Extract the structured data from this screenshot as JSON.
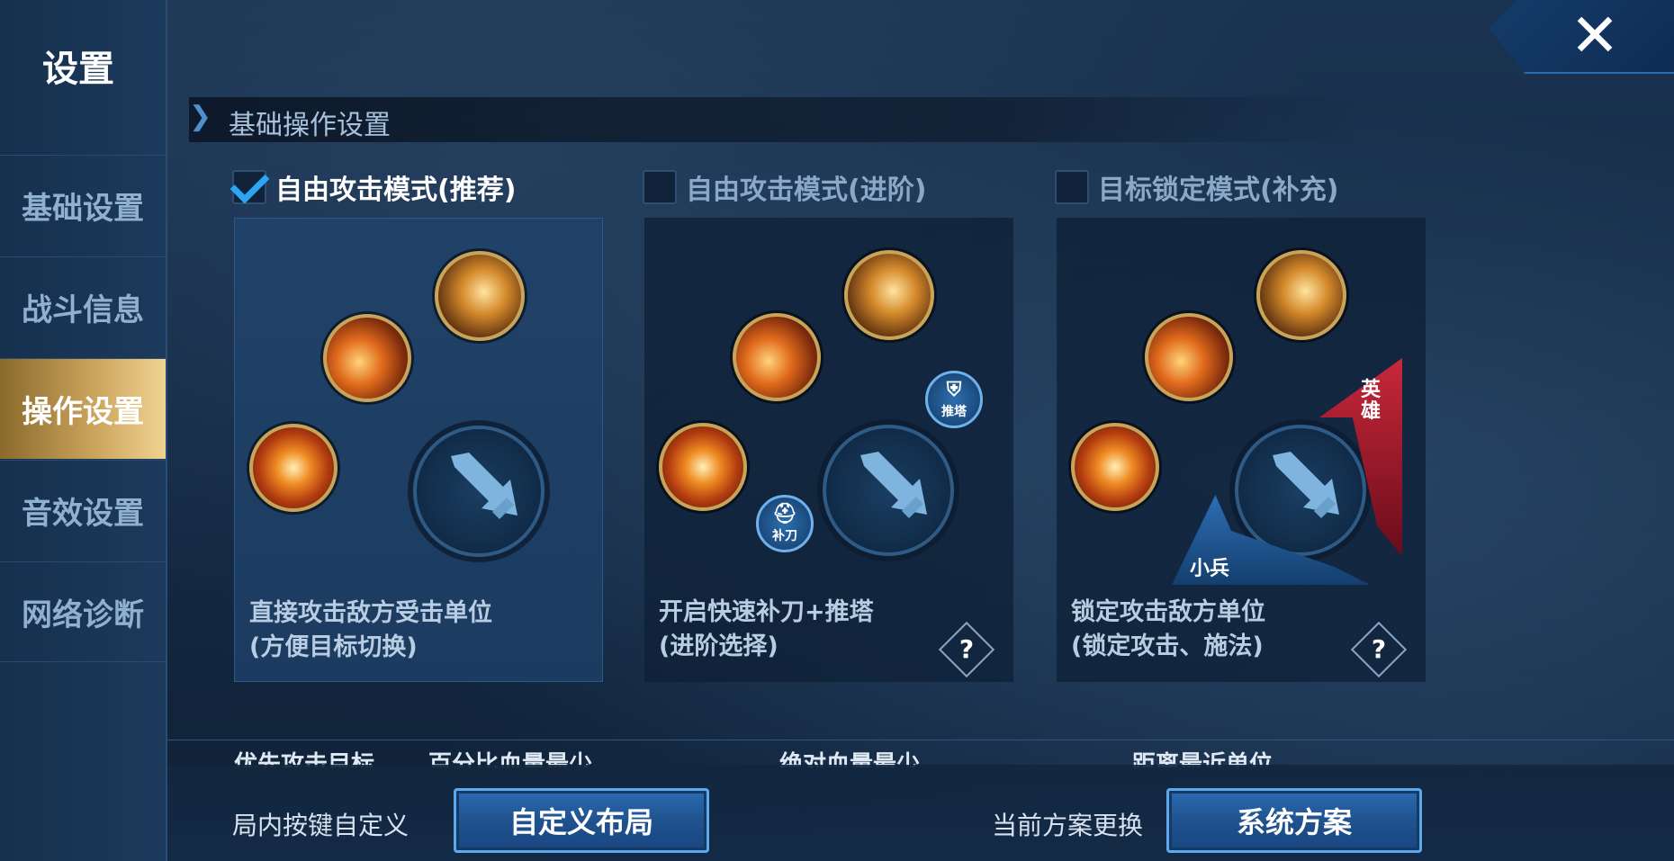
{
  "sidebar": {
    "title": "设置",
    "items": [
      {
        "label": "基础设置"
      },
      {
        "label": "战斗信息"
      },
      {
        "label": "操作设置"
      },
      {
        "label": "音效设置"
      },
      {
        "label": "网络诊断"
      }
    ],
    "active_index": 2
  },
  "close_label": "✕",
  "section": {
    "title": "基础操作设置"
  },
  "modes": [
    {
      "label": "自由攻击模式(推荐)",
      "checked": true,
      "desc_line1": "直接攻击敌方受击单位",
      "desc_line2": "(方便目标切换)"
    },
    {
      "label": "自由攻击模式(进阶)",
      "checked": false,
      "desc_line1": "开启快速补刀+推塔",
      "desc_line2": "(进阶选择)",
      "badge_tower": "推塔",
      "badge_lasthit": "补刀",
      "help": "?"
    },
    {
      "label": "目标锁定模式(补充)",
      "checked": false,
      "desc_line1": "锁定攻击敌方单位",
      "desc_line2": "(锁定攻击、施法)",
      "hero_label_1": "英",
      "hero_label_2": "雄",
      "minion_label": "小兵",
      "help": "?"
    }
  ],
  "priority_row": {
    "label": "优先攻击目标",
    "opt1": "百分比血量最少",
    "opt2": "绝对血量最少",
    "opt3": "距离最近单位"
  },
  "bottom": {
    "custom_keys_label": "局内按键自定义",
    "custom_layout_button": "自定义布局",
    "scheme_label": "当前方案更换",
    "system_scheme_button": "系统方案"
  },
  "colors": {
    "accent": "#2aa6f2",
    "active_tab": "#c9a25a",
    "hero": "#c8283a",
    "minion": "#2d6eb4"
  }
}
